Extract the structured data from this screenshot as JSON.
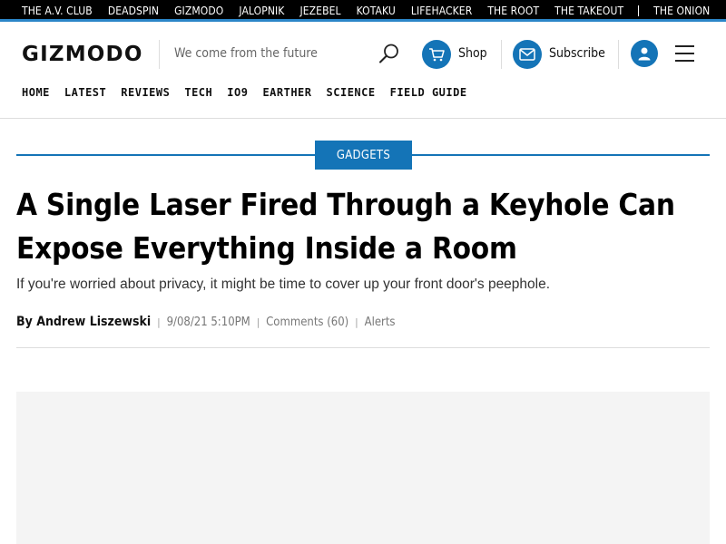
{
  "network_links": [
    "THE A.V. CLUB",
    "DEADSPIN",
    "GIZMODO",
    "JALOPNIK",
    "JEZEBEL",
    "KOTAKU",
    "LIFEHACKER",
    "THE ROOT",
    "THE TAKEOUT",
    "THE ONION"
  ],
  "header": {
    "logo": "GIZMODO",
    "tagline": "We come from the future",
    "shop_label": "Shop",
    "subscribe_label": "Subscribe"
  },
  "nav": [
    "HOME",
    "LATEST",
    "REVIEWS",
    "TECH",
    "IO9",
    "EARTHER",
    "SCIENCE",
    "FIELD GUIDE"
  ],
  "article": {
    "category": "GADGETS",
    "title": "A Single Laser Fired Through a Keyhole Can Expose Everything Inside a Room",
    "subtitle": "If you're worried about privacy, it might be time to cover up your front door's peephole.",
    "byline": "By Andrew Liszewski",
    "date": "9/08/21 5:10PM",
    "comments": "Comments (60)",
    "alerts": "Alerts"
  },
  "colors": {
    "accent": "#1474b7",
    "network_accent": "#2b86c8"
  }
}
